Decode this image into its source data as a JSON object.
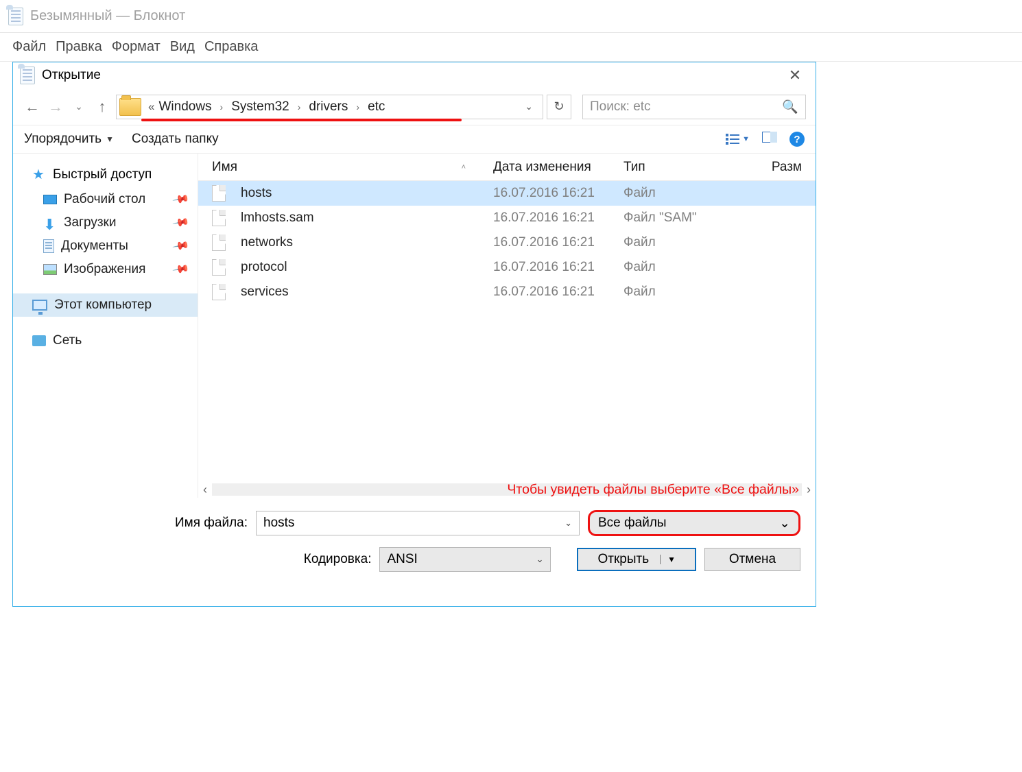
{
  "notepad": {
    "title": "Безымянный — Блокнот",
    "menu": {
      "file": "Файл",
      "edit": "Правка",
      "format": "Формат",
      "view": "Вид",
      "help": "Справка"
    }
  },
  "dialog": {
    "title": "Открытие",
    "breadcrumb": {
      "prefix": "«",
      "parts": [
        "Windows",
        "System32",
        "drivers",
        "etc"
      ]
    },
    "search_placeholder": "Поиск: etc",
    "toolbar": {
      "organize": "Упорядочить",
      "new_folder": "Создать папку"
    },
    "columns": {
      "name": "Имя",
      "date": "Дата изменения",
      "type": "Тип",
      "size": "Разм"
    },
    "files": [
      {
        "name": "hosts",
        "date": "16.07.2016 16:21",
        "type": "Файл",
        "selected": true
      },
      {
        "name": "lmhosts.sam",
        "date": "16.07.2016 16:21",
        "type": "Файл \"SAM\"",
        "selected": false
      },
      {
        "name": "networks",
        "date": "16.07.2016 16:21",
        "type": "Файл",
        "selected": false
      },
      {
        "name": "protocol",
        "date": "16.07.2016 16:21",
        "type": "Файл",
        "selected": false
      },
      {
        "name": "services",
        "date": "16.07.2016 16:21",
        "type": "Файл",
        "selected": false
      }
    ],
    "sidebar": {
      "quick": "Быстрый доступ",
      "desktop": "Рабочий стол",
      "downloads": "Загрузки",
      "documents": "Документы",
      "pictures": "Изображения",
      "thispc": "Этот компьютер",
      "network": "Сеть"
    },
    "hint": "Чтобы увидеть файлы выберите «Все файлы»",
    "form": {
      "filename_label": "Имя файла:",
      "filename_value": "hosts",
      "filter_value": "Все файлы",
      "encoding_label": "Кодировка:",
      "encoding_value": "ANSI",
      "open": "Открыть",
      "cancel": "Отмена"
    }
  }
}
